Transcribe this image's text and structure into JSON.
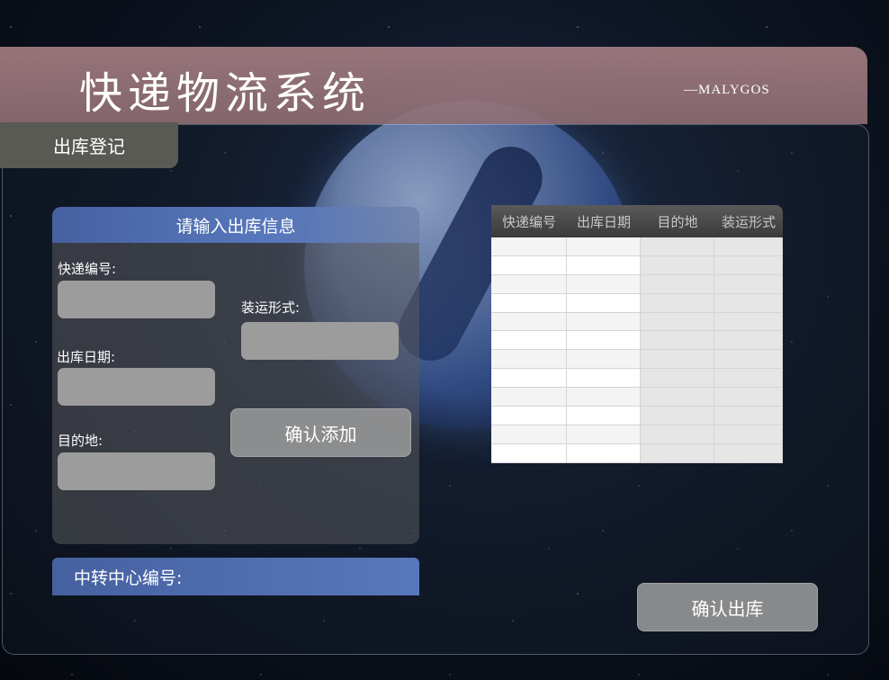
{
  "app": {
    "title": "快递物流系统",
    "brand": "—MALYGOS"
  },
  "section": {
    "tab_label": "出库登记"
  },
  "form": {
    "title": "请输入出库信息",
    "fields": {
      "tracking_number": {
        "label": "快递编号:",
        "value": ""
      },
      "ship_date": {
        "label": "出库日期:",
        "value": ""
      },
      "destination": {
        "label": "目的地:",
        "value": ""
      },
      "shipping_method": {
        "label": "装运形式:",
        "value": ""
      }
    },
    "add_button": "确认添加"
  },
  "table": {
    "columns": [
      "快递编号",
      "出库日期",
      "目的地",
      "装运形式"
    ],
    "rows": [
      [
        "",
        "",
        "",
        ""
      ],
      [
        "",
        "",
        "",
        ""
      ],
      [
        "",
        "",
        "",
        ""
      ],
      [
        "",
        "",
        "",
        ""
      ],
      [
        "",
        "",
        "",
        ""
      ],
      [
        "",
        "",
        "",
        ""
      ],
      [
        "",
        "",
        "",
        ""
      ],
      [
        "",
        "",
        "",
        ""
      ],
      [
        "",
        "",
        "",
        ""
      ],
      [
        "",
        "",
        "",
        ""
      ],
      [
        "",
        "",
        "",
        ""
      ],
      [
        "",
        "",
        "",
        ""
      ]
    ]
  },
  "transfer": {
    "label": "中转中心编号:"
  },
  "confirm_button": "确认出库",
  "colors": {
    "header": "#97767b",
    "accent_blue": "#4f6db0",
    "panel_gray": "#5a5a55"
  }
}
